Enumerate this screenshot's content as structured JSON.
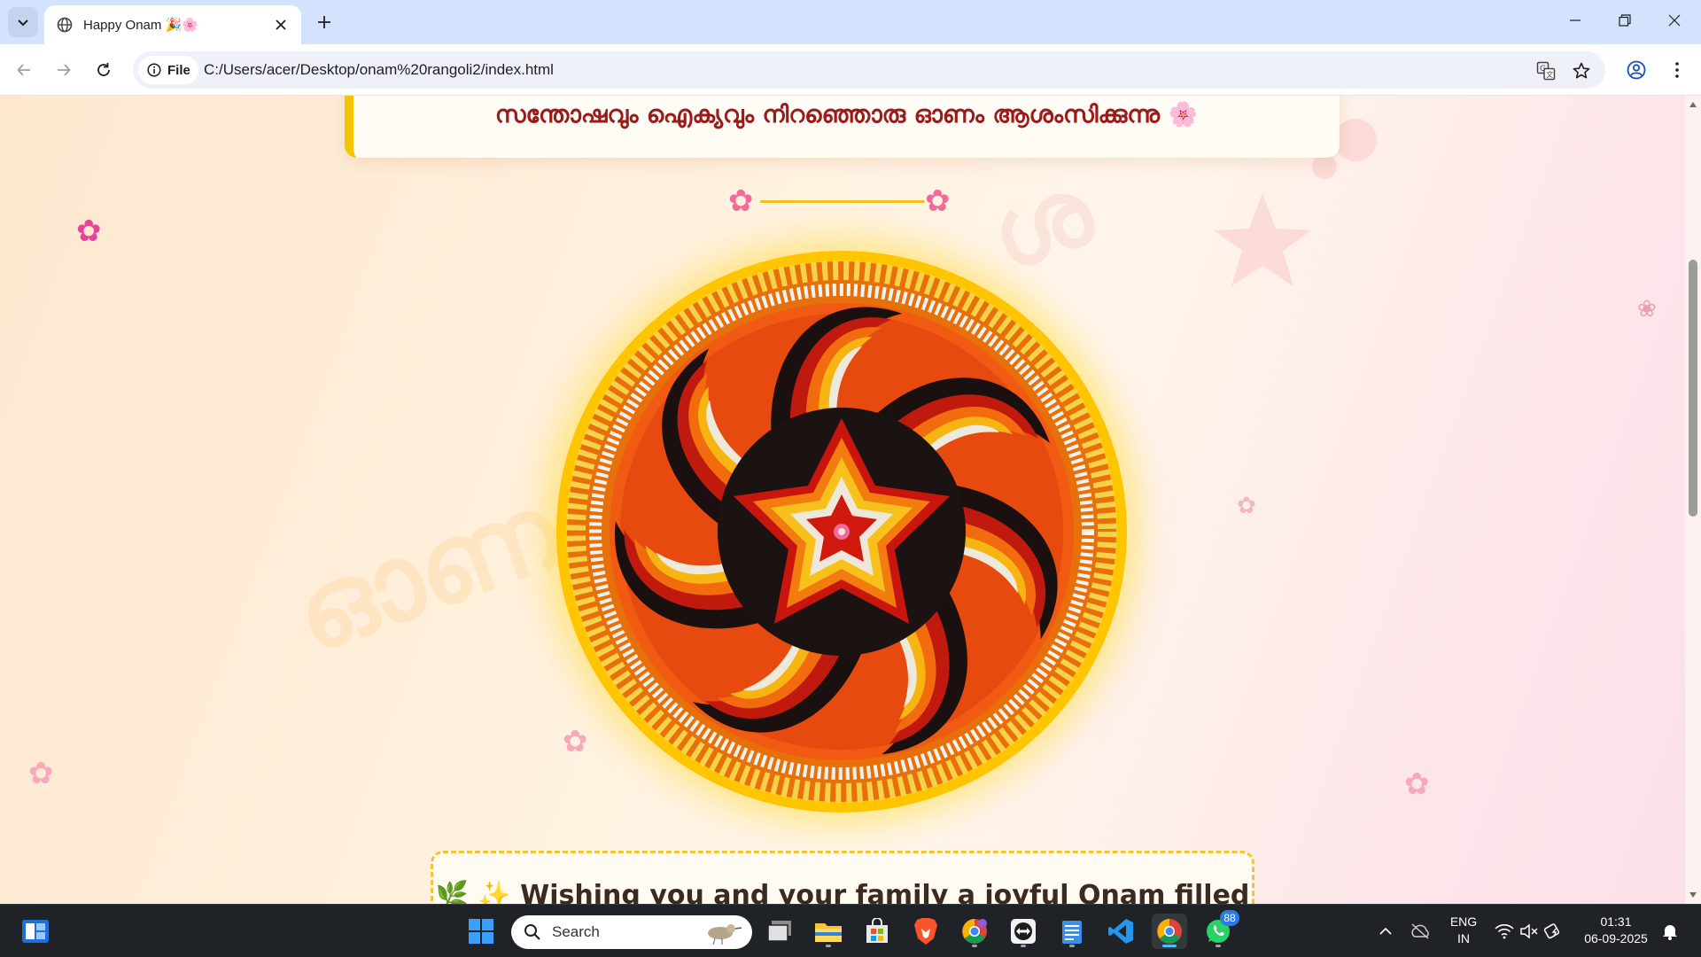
{
  "browser": {
    "tab_title": "Happy Onam 🎉🌸",
    "site_chip_label": "File",
    "url": "C:/Users/acer/Desktop/onam%20rangoli2/index.html"
  },
  "page": {
    "greeting_malayalam": "സന്തോഷവും ഐക്യവും നിറഞ്ഞൊരു ഓണം ആശംസിക്കുന്നു 🌸",
    "watermark_left": "ഓണ",
    "watermark_right": "ശ",
    "wish_text": "🌿 ✨ Wishing you and your family a joyful Onam filled"
  },
  "taskbar": {
    "search_placeholder": "Search",
    "whatsapp_badge": "88",
    "language_line1": "ENG",
    "language_line2": "IN",
    "time": "01:31",
    "date": "06-09-2025"
  },
  "colors": {
    "tab_strip": "#d3e3fd",
    "heading_red": "#9b1a1a",
    "gold": "#f5c400",
    "taskbar": "#1f2327"
  }
}
